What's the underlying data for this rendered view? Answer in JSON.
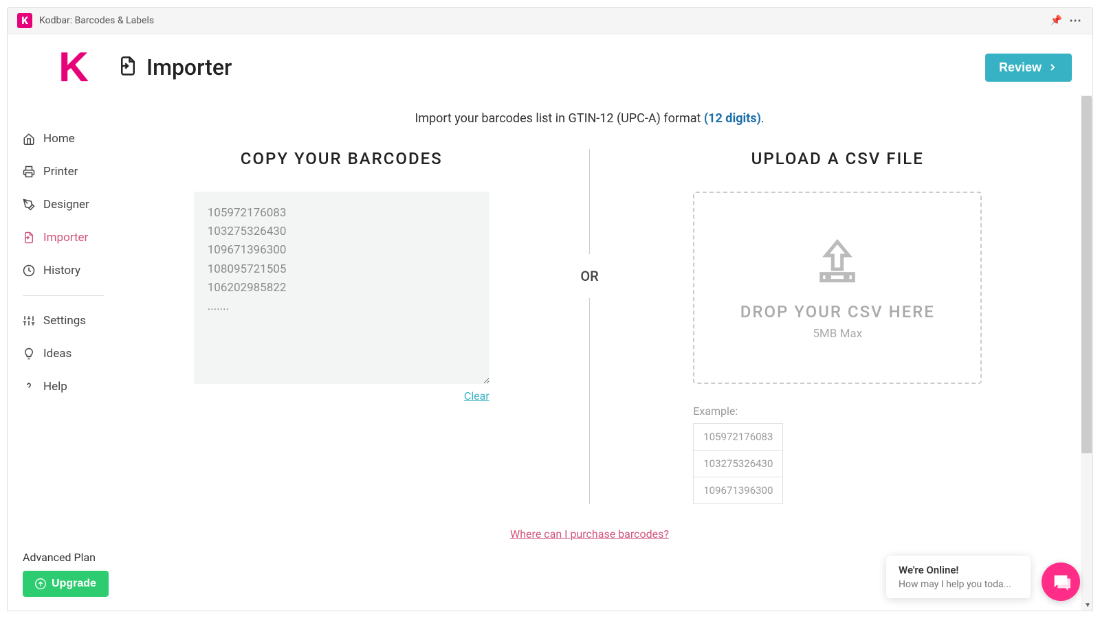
{
  "window": {
    "title": "Kodbar: Barcodes & Labels",
    "app_icon_letter": "K"
  },
  "header": {
    "page_title": "Importer",
    "review_button": "Review"
  },
  "sidebar": {
    "items": [
      {
        "label": "Home",
        "id": "home"
      },
      {
        "label": "Printer",
        "id": "printer"
      },
      {
        "label": "Designer",
        "id": "designer"
      },
      {
        "label": "Importer",
        "id": "importer",
        "active": true
      },
      {
        "label": "History",
        "id": "history"
      }
    ],
    "secondary": [
      {
        "label": "Settings",
        "id": "settings"
      },
      {
        "label": "Ideas",
        "id": "ideas"
      },
      {
        "label": "Help",
        "id": "help"
      }
    ],
    "plan_label": "Advanced Plan",
    "upgrade_label": "Upgrade"
  },
  "main": {
    "instruction_prefix": "Import your barcodes list in GTIN-12 (UPC-A) format ",
    "instruction_highlight": "(12 digits)",
    "instruction_suffix": ".",
    "left": {
      "heading": "COPY YOUR BARCODES",
      "placeholder": "105972176083\n103275326430\n109671396300\n108095721505\n106202985822\n.......",
      "clear_label": "Clear"
    },
    "or_label": "OR",
    "right": {
      "heading": "UPLOAD A CSV FILE",
      "drop_text": "DROP YOUR CSV HERE",
      "drop_sub": "5MB Max",
      "example_label": "Example:",
      "example_rows": [
        "105972176083",
        "103275326430",
        "109671396300"
      ]
    },
    "purchase_link": "Where can I purchase barcodes?"
  },
  "chat": {
    "line1": "We're Online!",
    "line2": "How may I help you toda..."
  }
}
